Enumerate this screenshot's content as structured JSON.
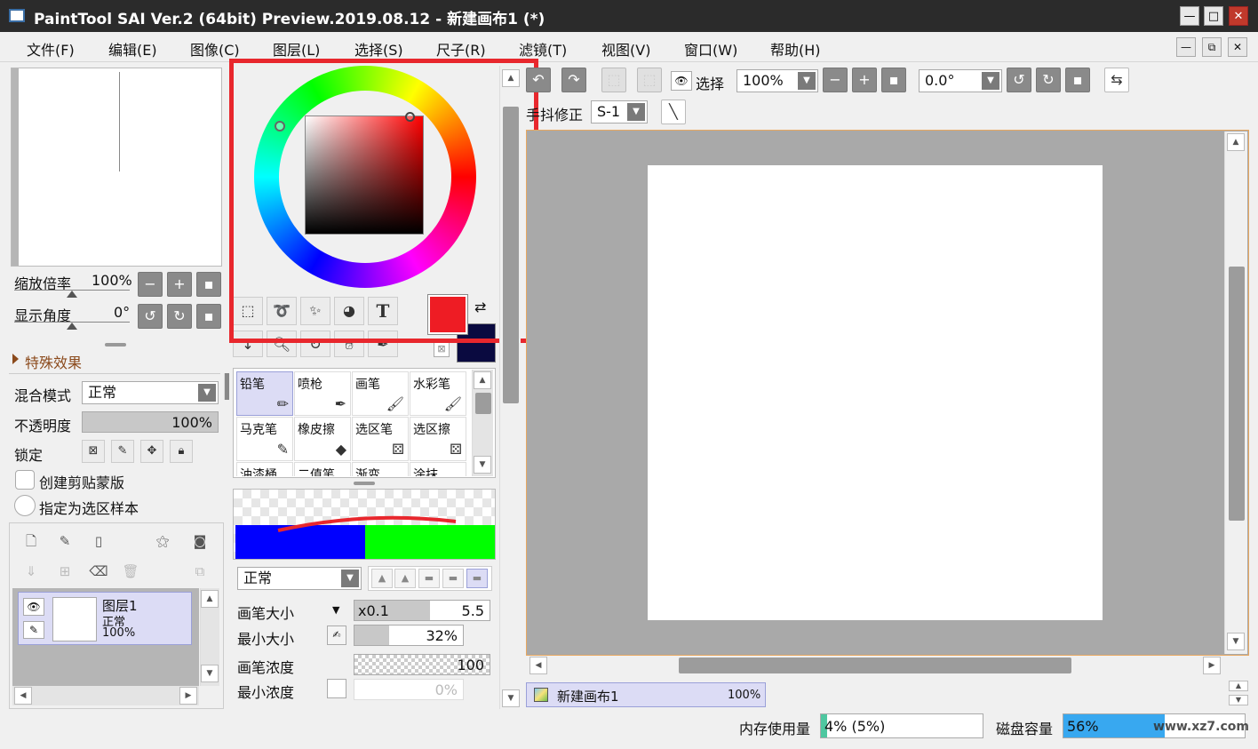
{
  "window": {
    "title": "PaintTool SAI Ver.2 (64bit) Preview.2019.08.12 - 新建画布1 (*)",
    "minimize": "—",
    "maximize": "□",
    "close": "✕"
  },
  "menu": {
    "items": [
      "文件(F)",
      "编辑(E)",
      "图像(C)",
      "图层(L)",
      "选择(S)",
      "尺子(R)",
      "滤镜(T)",
      "视图(V)",
      "窗口(W)",
      "帮助(H)"
    ]
  },
  "navigator": {
    "zoom_label": "缩放倍率",
    "zoom_value": "100%",
    "angle_label": "显示角度",
    "angle_value": "0°"
  },
  "special_effects": {
    "label": "特殊效果"
  },
  "layer_props": {
    "blend_label": "混合模式",
    "blend_value": "正常",
    "opacity_label": "不透明度",
    "opacity_value": "100%",
    "opacity_fraction": 1.0,
    "lock_label": "锁定",
    "clip_label": "创建剪贴蒙版",
    "sample_label": "指定为选区样本"
  },
  "layers": [
    {
      "name": "图层1",
      "mode": "正常",
      "opacity": "100%"
    }
  ],
  "colors": {
    "primary": "#ee1c24",
    "secondary": "#0a0a40",
    "accent_red": "#e8272d",
    "highlight": "#dcdcf5"
  },
  "tools": {
    "text_tool": "T"
  },
  "brushes": [
    {
      "label": "铅笔",
      "icon": "pencil-icon",
      "selected": true
    },
    {
      "label": "喷枪",
      "icon": "airbrush-icon",
      "selected": false
    },
    {
      "label": "画笔",
      "icon": "brush-icon",
      "selected": false
    },
    {
      "label": "水彩笔",
      "icon": "watercolor-icon",
      "selected": false
    },
    {
      "label": "马克笔",
      "icon": "marker-icon",
      "selected": false
    },
    {
      "label": "橡皮擦",
      "icon": "eraser-icon",
      "selected": false
    },
    {
      "label": "选区笔",
      "icon": "select-pen-icon",
      "selected": false
    },
    {
      "label": "选区擦",
      "icon": "select-eraser-icon",
      "selected": false
    },
    {
      "label": "油漆桶",
      "icon": "bucket-icon",
      "selected": false
    },
    {
      "label": "二值笔",
      "icon": "binary-pen-icon",
      "selected": false
    },
    {
      "label": "渐变",
      "icon": "gradient-icon",
      "selected": false
    },
    {
      "label": "涂抹",
      "icon": "smudge-icon",
      "selected": false
    }
  ],
  "brush_settings": {
    "mode_value": "正常",
    "size_label": "画笔大小",
    "size_multiplier": "x0.1",
    "size_value": "5.5",
    "min_size_label": "最小大小",
    "min_size_value": "32%",
    "min_size_fraction": 0.32,
    "density_label": "画笔浓度",
    "density_value": "100",
    "min_density_label": "最小浓度",
    "min_density_value": "0%"
  },
  "toolbar": {
    "select_label": "选择",
    "zoom_value": "100%",
    "rotation_value": "0.0°",
    "stabilizer_label": "手抖修正",
    "stabilizer_value": "S-1"
  },
  "canvas_tab": {
    "name": "新建画布1",
    "zoom": "100%"
  },
  "status": {
    "memory_label": "内存使用量",
    "memory_value": "4% (5%)",
    "memory_fraction": 0.04,
    "disk_label": "磁盘容量",
    "disk_value": "56%",
    "disk_fraction": 0.56
  },
  "watermark": "www.xz7.com"
}
